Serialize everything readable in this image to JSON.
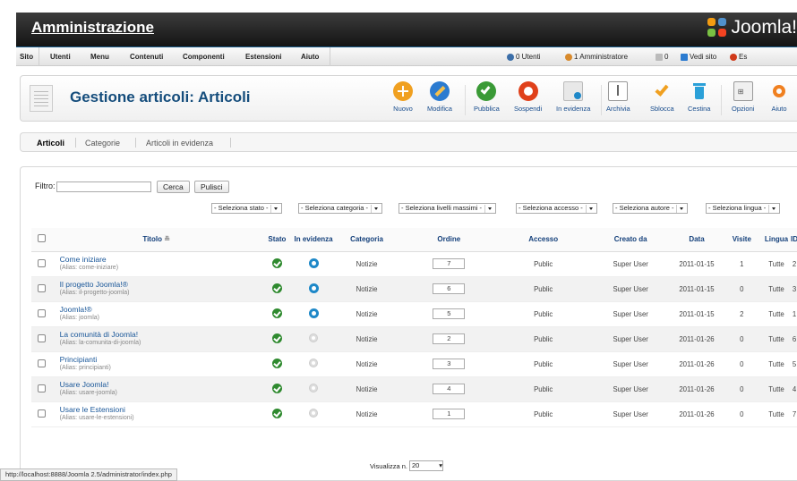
{
  "header": {
    "title": "Amministrazione",
    "brand": "Joomla!"
  },
  "menu": {
    "items": [
      "Sito",
      "Utenti",
      "Menu",
      "Contenuti",
      "Componenti",
      "Estensioni",
      "Aiuto"
    ],
    "status": {
      "users": "0 Utenti",
      "admins": "1 Amministratore",
      "messages": "0",
      "view_site": "Vedi sito",
      "logout": "Es"
    }
  },
  "toolbar": {
    "page_title": "Gestione articoli: Articoli",
    "buttons": [
      {
        "label": "Nuovo",
        "icon": "plus-icon",
        "color": "#f0a020"
      },
      {
        "label": "Modifica",
        "icon": "pencil-icon",
        "color": "#2b7bd0"
      },
      {
        "label": "Pubblica",
        "icon": "check-icon",
        "color": "#3a9a36"
      },
      {
        "label": "Sospendi",
        "icon": "stop-icon",
        "color": "#e0401a"
      },
      {
        "label": "In evidenza",
        "icon": "featured-icon",
        "color": "#999999"
      },
      {
        "label": "Archivia",
        "icon": "archive-icon",
        "color": "#999999"
      },
      {
        "label": "Sblocca",
        "icon": "checkin-icon",
        "color": "#f0a020"
      },
      {
        "label": "Cestina",
        "icon": "trash-icon",
        "color": "#2ba0d8"
      },
      {
        "label": "Opzioni",
        "icon": "options-icon",
        "color": "#999999"
      },
      {
        "label": "Aiuto",
        "icon": "help-icon",
        "color": "#f08020"
      }
    ]
  },
  "tabs": [
    {
      "label": "Articoli",
      "active": true
    },
    {
      "label": "Categorie",
      "active": false
    },
    {
      "label": "Articoli in evidenza",
      "active": false
    }
  ],
  "filter": {
    "label": "Filtro:",
    "value": "",
    "search_btn": "Cerca",
    "clear_btn": "Pulisci",
    "selects": [
      "- Seleziona stato -",
      "- Seleziona categoria -",
      "- Seleziona livelli massimi -",
      "- Seleziona accesso -",
      "- Seleziona autore -",
      "- Seleziona lingua -"
    ]
  },
  "table": {
    "headers": {
      "title": "Titolo",
      "status": "Stato",
      "featured": "In evidenza",
      "category": "Categoria",
      "order": "Ordine",
      "access": "Accesso",
      "created_by": "Creato da",
      "date": "Data",
      "hits": "Visite",
      "language": "Lingua",
      "id": "ID"
    },
    "rows": [
      {
        "title": "Come iniziare",
        "alias": "(Alias: come-iniziare)",
        "featured": true,
        "category": "Notizie",
        "order": "7",
        "access": "Public",
        "author": "Super User",
        "date": "2011-01-15",
        "hits": "1",
        "language": "Tutte",
        "id": "2"
      },
      {
        "title": "Il progetto Joomla!®",
        "alias": "(Alias: il-progetto-joomla)",
        "featured": true,
        "category": "Notizie",
        "order": "6",
        "access": "Public",
        "author": "Super User",
        "date": "2011-01-15",
        "hits": "0",
        "language": "Tutte",
        "id": "3"
      },
      {
        "title": "Joomla!®",
        "alias": "(Alias: joomla)",
        "featured": true,
        "category": "Notizie",
        "order": "5",
        "access": "Public",
        "author": "Super User",
        "date": "2011-01-15",
        "hits": "2",
        "language": "Tutte",
        "id": "1"
      },
      {
        "title": "La comunità di Joomla!",
        "alias": "(Alias: la-comunita-di-joomla)",
        "featured": false,
        "category": "Notizie",
        "order": "2",
        "access": "Public",
        "author": "Super User",
        "date": "2011-01-26",
        "hits": "0",
        "language": "Tutte",
        "id": "6"
      },
      {
        "title": "Principianti",
        "alias": "(Alias: principianti)",
        "featured": false,
        "category": "Notizie",
        "order": "3",
        "access": "Public",
        "author": "Super User",
        "date": "2011-01-26",
        "hits": "0",
        "language": "Tutte",
        "id": "5"
      },
      {
        "title": "Usare Joomla!",
        "alias": "(Alias: usare-joomla)",
        "featured": false,
        "category": "Notizie",
        "order": "4",
        "access": "Public",
        "author": "Super User",
        "date": "2011-01-26",
        "hits": "0",
        "language": "Tutte",
        "id": "4"
      },
      {
        "title": "Usare le Estensioni",
        "alias": "(Alias: usare-le-estensioni)",
        "featured": false,
        "category": "Notizie",
        "order": "1",
        "access": "Public",
        "author": "Super User",
        "date": "2011-01-26",
        "hits": "0",
        "language": "Tutte",
        "id": "7"
      }
    ]
  },
  "pagination": {
    "label": "Visualizza n.",
    "value": "20"
  },
  "statusbar": {
    "url": "http://localhost:8888/Joomla 2.5/administrator/index.php"
  }
}
